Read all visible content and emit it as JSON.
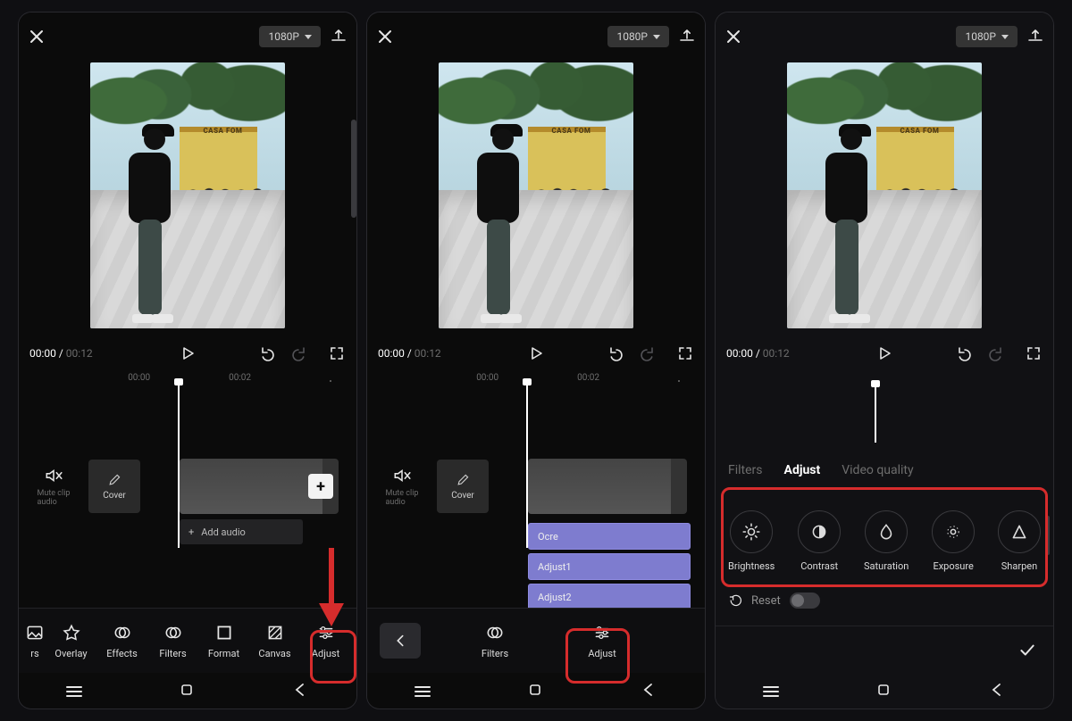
{
  "common": {
    "resolution_label": "1080P",
    "time_current": "00:00",
    "time_total": "00:12",
    "axis_labels": [
      "00:00",
      "00:02"
    ],
    "mute": {
      "line1": "Mute clip",
      "line2": "audio"
    },
    "cover_label": "Cover",
    "add_audio": "Add audio",
    "sign_text": "CASA FOM"
  },
  "p1": {
    "tools": [
      "rs",
      "Overlay",
      "Effects",
      "Filters",
      "Format",
      "Canvas",
      "Adjust"
    ]
  },
  "p2": {
    "tracks": [
      "Ocre",
      "Adjust1",
      "Adjust2"
    ],
    "tools": [
      "Filters",
      "Adjust"
    ]
  },
  "p3": {
    "tabs": [
      "Filters",
      "Adjust",
      "Video quality"
    ],
    "active_tab": "Adjust",
    "adjust_items": [
      "Brightness",
      "Contrast",
      "Saturation",
      "Exposure",
      "Sharpen"
    ],
    "reset_label": "Reset"
  }
}
